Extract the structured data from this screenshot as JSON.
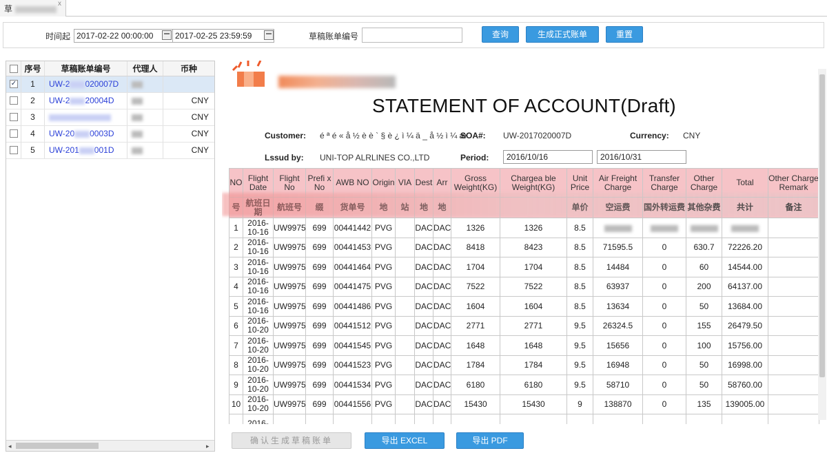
{
  "tab": {
    "title": "草",
    "close": "x"
  },
  "filter": {
    "time_label": "时间起",
    "start": "2017-02-22 00:00:00",
    "end": "2017-02-25 23:59:59",
    "draft_no_label": "草稿账单编号",
    "draft_no_value": "",
    "query": "查询",
    "generate": "生成正式账单",
    "reset": "重置"
  },
  "list": {
    "headers": [
      "序号",
      "草稿账单编号",
      "代理人",
      "币种"
    ],
    "rows": [
      {
        "no": "1",
        "code": "UW-2",
        "code_end": "020007D",
        "agent": "",
        "currency": "",
        "checked": true
      },
      {
        "no": "2",
        "code": "UW-2",
        "code_end": "20004D",
        "agent": "",
        "currency": "CNY",
        "checked": false
      },
      {
        "no": "3",
        "code": "",
        "code_end": "",
        "agent": "",
        "currency": "CNY",
        "checked": false
      },
      {
        "no": "4",
        "code": "UW-20",
        "code_end": "0003D",
        "agent": "",
        "currency": "CNY",
        "checked": false
      },
      {
        "no": "5",
        "code": "UW-201",
        "code_end": "001D",
        "agent": "",
        "currency": "CNY",
        "checked": false
      }
    ]
  },
  "doc": {
    "title": "STATEMENT OF ACCOUNT(Draft)",
    "customer_label": "Customer:",
    "customer_value": "é ª é « å ½ è è ` § è ¿ ì ¼ ä _ å ½ ì ¼ æ",
    "soa_label": "SOA#:",
    "soa_value": "UW-2017020007D",
    "currency_label": "Currency:",
    "currency_value": "CNY",
    "issued_label": "Lssud by:",
    "issued_value": "UNI-TOP ALRLINES CO.,LTD",
    "period_label": "Period:",
    "period_from": "2016/10/16",
    "period_to": "2016/10/31"
  },
  "table": {
    "head_en": [
      "NO",
      "Flight Date",
      "Flight No",
      "Prefi x No",
      "AWB NO",
      "Origin",
      "VIA",
      "Dest",
      "Arr",
      "Gross Weight(KG)",
      "Chargea ble Weight(KG)",
      "Unit Price",
      "Air Freight Charge",
      "Transfer Charge",
      "Other Charge",
      "Total",
      "Other Charge Remark"
    ],
    "head_cn": [
      "号",
      "航班日期",
      "航班号",
      "缀",
      "货单号",
      "地",
      "站",
      "地",
      "地",
      "",
      "",
      "单价",
      "空运费",
      "国外转运费",
      "其他杂费",
      "共计",
      "备注"
    ],
    "rows": [
      {
        "no": "1",
        "date": "2016-10-16",
        "flight": "UW9975",
        "prefix": "699",
        "awb": "00441442",
        "origin": "PVG",
        "via": "",
        "dest": "DAC",
        "arr": "DAC",
        "gross": "1326",
        "chargeable": "1326",
        "unit": "8.5",
        "air": "",
        "transfer": "",
        "other": "",
        "total": "",
        "remark": ""
      },
      {
        "no": "2",
        "date": "2016-10-16",
        "flight": "UW9975",
        "prefix": "699",
        "awb": "00441453",
        "origin": "PVG",
        "via": "",
        "dest": "DAC",
        "arr": "DAC",
        "gross": "8418",
        "chargeable": "8423",
        "unit": "8.5",
        "air": "71595.5",
        "transfer": "0",
        "other": "630.7",
        "total": "72226.20",
        "remark": ""
      },
      {
        "no": "3",
        "date": "2016-10-16",
        "flight": "UW9975",
        "prefix": "699",
        "awb": "00441464",
        "origin": "PVG",
        "via": "",
        "dest": "DAC",
        "arr": "DAC",
        "gross": "1704",
        "chargeable": "1704",
        "unit": "8.5",
        "air": "14484",
        "transfer": "0",
        "other": "60",
        "total": "14544.00",
        "remark": ""
      },
      {
        "no": "4",
        "date": "2016-10-16",
        "flight": "UW9975",
        "prefix": "699",
        "awb": "00441475",
        "origin": "PVG",
        "via": "",
        "dest": "DAC",
        "arr": "DAC",
        "gross": "7522",
        "chargeable": "7522",
        "unit": "8.5",
        "air": "63937",
        "transfer": "0",
        "other": "200",
        "total": "64137.00",
        "remark": ""
      },
      {
        "no": "5",
        "date": "2016-10-16",
        "flight": "UW9975",
        "prefix": "699",
        "awb": "00441486",
        "origin": "PVG",
        "via": "",
        "dest": "DAC",
        "arr": "DAC",
        "gross": "1604",
        "chargeable": "1604",
        "unit": "8.5",
        "air": "13634",
        "transfer": "0",
        "other": "50",
        "total": "13684.00",
        "remark": ""
      },
      {
        "no": "6",
        "date": "2016-10-20",
        "flight": "UW9975",
        "prefix": "699",
        "awb": "00441512",
        "origin": "PVG",
        "via": "",
        "dest": "DAC",
        "arr": "DAC",
        "gross": "2771",
        "chargeable": "2771",
        "unit": "9.5",
        "air": "26324.5",
        "transfer": "0",
        "other": "155",
        "total": "26479.50",
        "remark": ""
      },
      {
        "no": "7",
        "date": "2016-10-20",
        "flight": "UW9975",
        "prefix": "699",
        "awb": "00441545",
        "origin": "PVG",
        "via": "",
        "dest": "DAC",
        "arr": "DAC",
        "gross": "1648",
        "chargeable": "1648",
        "unit": "9.5",
        "air": "15656",
        "transfer": "0",
        "other": "100",
        "total": "15756.00",
        "remark": ""
      },
      {
        "no": "8",
        "date": "2016-10-20",
        "flight": "UW9975",
        "prefix": "699",
        "awb": "00441523",
        "origin": "PVG",
        "via": "",
        "dest": "DAC",
        "arr": "DAC",
        "gross": "1784",
        "chargeable": "1784",
        "unit": "9.5",
        "air": "16948",
        "transfer": "0",
        "other": "50",
        "total": "16998.00",
        "remark": ""
      },
      {
        "no": "9",
        "date": "2016-10-20",
        "flight": "UW9975",
        "prefix": "699",
        "awb": "00441534",
        "origin": "PVG",
        "via": "",
        "dest": "DAC",
        "arr": "DAC",
        "gross": "6180",
        "chargeable": "6180",
        "unit": "9.5",
        "air": "58710",
        "transfer": "0",
        "other": "50",
        "total": "58760.00",
        "remark": ""
      },
      {
        "no": "10",
        "date": "2016-10-20",
        "flight": "UW9975",
        "prefix": "699",
        "awb": "00441556",
        "origin": "PVG",
        "via": "",
        "dest": "DAC",
        "arr": "DAC",
        "gross": "15430",
        "chargeable": "15430",
        "unit": "9",
        "air": "138870",
        "transfer": "0",
        "other": "135",
        "total": "139005.00",
        "remark": ""
      },
      {
        "no": "",
        "date": "2016-",
        "flight": "",
        "prefix": "",
        "awb": "",
        "origin": "",
        "via": "",
        "dest": "",
        "arr": "",
        "gross": "",
        "chargeable": "",
        "unit": "",
        "air": "",
        "transfer": "",
        "other": "",
        "total": "",
        "remark": ""
      }
    ]
  },
  "bottom": {
    "confirm": "确认生成草稿账单",
    "export_excel": "导出 EXCEL",
    "export_pdf": "导出 PDF"
  },
  "colors": {
    "header_pink": "#f6c3c7",
    "button_blue": "#3a9ae0",
    "link_blue": "#2a3fd8"
  }
}
